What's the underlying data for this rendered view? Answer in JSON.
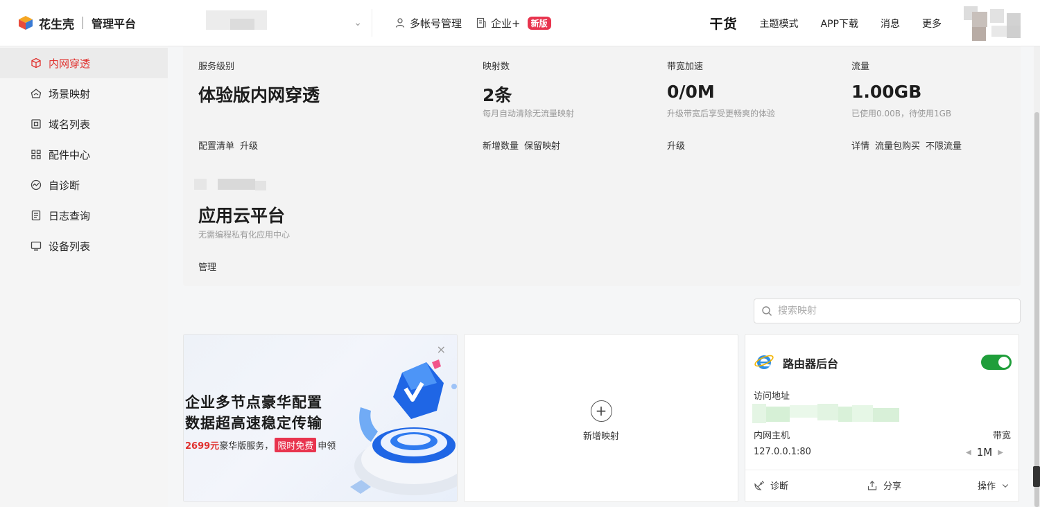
{
  "brand": {
    "name": "花生壳",
    "subtitle": "管理平台"
  },
  "sidebar": {
    "items": [
      {
        "label": "内网穿透",
        "icon": "cube-icon",
        "active": true
      },
      {
        "label": "场景映射",
        "icon": "house-icon",
        "active": false
      },
      {
        "label": "域名列表",
        "icon": "domain-icon",
        "active": false
      },
      {
        "label": "配件中心",
        "icon": "grid-icon",
        "active": false
      },
      {
        "label": "自诊断",
        "icon": "diagnose-icon",
        "active": false
      },
      {
        "label": "日志查询",
        "icon": "log-icon",
        "active": false
      },
      {
        "label": "设备列表",
        "icon": "monitor-icon",
        "active": false
      }
    ]
  },
  "topbar": {
    "multi_account": "多帐号管理",
    "enterprise": "企业+",
    "new_badge": "新版",
    "ganhuo": "干货",
    "links": [
      "主题模式",
      "APP下载",
      "消息",
      "更多"
    ]
  },
  "summary": {
    "service": {
      "label": "服务级别",
      "value": "体验版内网穿透",
      "actions": [
        "配置清单",
        "升级"
      ]
    },
    "mappings": {
      "label": "映射数",
      "value": "2条",
      "note": "每月自动清除无流量映射",
      "actions": [
        "新增数量",
        "保留映射"
      ]
    },
    "bandwidth": {
      "label": "带宽加速",
      "value": "0/0M",
      "note": "升级带宽后享受更畅爽的体验",
      "actions": [
        "升级"
      ]
    },
    "traffic": {
      "label": "流量",
      "value": "1.00GB",
      "note": "已使用0.00B，待使用1GB",
      "actions": [
        "详情",
        "流量包购买",
        "不限流量"
      ]
    },
    "cloud": {
      "value": "应用云平台",
      "note": "无需编程私有化应用中心",
      "actions": [
        "管理"
      ]
    }
  },
  "search": {
    "placeholder": "搜索映射"
  },
  "promo": {
    "line1": "企业多节点豪华配置",
    "line2": "数据超高速稳定传输",
    "price": "2699元",
    "text_mid": "豪华版服务，",
    "tag": "限时免费",
    "text_end": "申领"
  },
  "add_mapping": {
    "label": "新增映射"
  },
  "mapping_card": {
    "title": "路由器后台",
    "access_label": "访问地址",
    "host_label": "内网主机",
    "host_value": "127.0.0.1:80",
    "bandwidth_label": "带宽",
    "bandwidth_value": "1M",
    "enabled": true,
    "diagnose": "诊断",
    "share": "分享",
    "operate": "操作"
  },
  "colors": {
    "accent_red": "#e0322f",
    "toggle_green": "#1f9e3a",
    "badge_pink": "#e8344e"
  }
}
